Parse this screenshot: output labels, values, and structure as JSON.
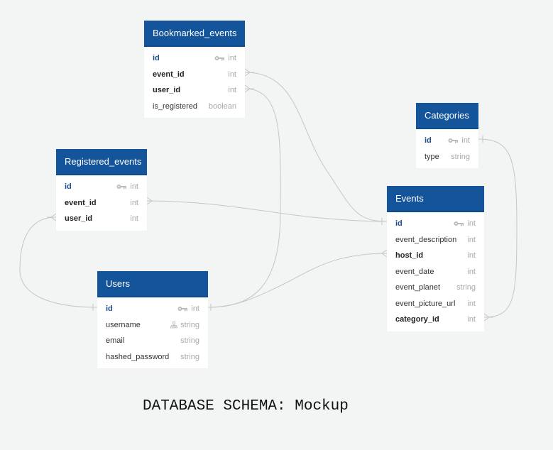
{
  "colors": {
    "background": "#f3f4f4",
    "header": "#14549a",
    "pk_text": "#1d4f8a",
    "type_text": "#a7a9ab",
    "link": "#c4c6c8"
  },
  "tables": {
    "bookmarked_events": {
      "name": "Bookmarked_events",
      "fields": [
        {
          "name": "id",
          "type": "int",
          "pk": true,
          "icon": "key-icon"
        },
        {
          "name": "event_id",
          "type": "int",
          "bold": true
        },
        {
          "name": "user_id",
          "type": "int",
          "bold": true
        },
        {
          "name": "is_registered",
          "type": "boolean"
        }
      ]
    },
    "registered_events": {
      "name": "Registered_events",
      "fields": [
        {
          "name": "id",
          "type": "int",
          "pk": true,
          "icon": "key-icon"
        },
        {
          "name": "event_id",
          "type": "int",
          "bold": true
        },
        {
          "name": "user_id",
          "type": "int",
          "bold": true
        }
      ]
    },
    "categories": {
      "name": "Categories",
      "fields": [
        {
          "name": "id",
          "type": "int",
          "pk": true,
          "icon": "key-icon"
        },
        {
          "name": "type",
          "type": "string"
        }
      ]
    },
    "events": {
      "name": "Events",
      "fields": [
        {
          "name": "id",
          "type": "int",
          "pk": true,
          "icon": "key-icon"
        },
        {
          "name": "event_description",
          "type": "int"
        },
        {
          "name": "host_id",
          "type": "int",
          "bold": true
        },
        {
          "name": "event_date",
          "type": "int"
        },
        {
          "name": "event_planet",
          "type": "string"
        },
        {
          "name": "event_picture_url",
          "type": "int"
        },
        {
          "name": "category_id",
          "type": "int",
          "bold": true
        }
      ]
    },
    "users": {
      "name": "Users",
      "fields": [
        {
          "name": "id",
          "type": "int",
          "pk": true,
          "icon": "key-icon"
        },
        {
          "name": "username",
          "type": "string",
          "icon": "unique-index-icon"
        },
        {
          "name": "email",
          "type": "string"
        },
        {
          "name": "hashed_password",
          "type": "string"
        }
      ]
    }
  },
  "relationships": [
    {
      "from": "Bookmarked_events.event_id",
      "to": "Events.id",
      "type": "many-to-one"
    },
    {
      "from": "Bookmarked_events.user_id",
      "to": "Users.id",
      "type": "many-to-one"
    },
    {
      "from": "Registered_events.event_id",
      "to": "Events.id",
      "type": "many-to-one"
    },
    {
      "from": "Registered_events.user_id",
      "to": "Users.id",
      "type": "many-to-one"
    },
    {
      "from": "Events.host_id",
      "to": "Users.id",
      "type": "many-to-one"
    },
    {
      "from": "Events.category_id",
      "to": "Categories.id",
      "type": "many-to-one"
    }
  ],
  "caption": "DATABASE SCHEMA: Mockup"
}
